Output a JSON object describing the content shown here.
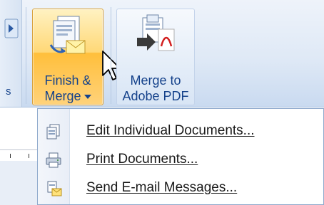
{
  "ribbon": {
    "left_group_stub_label": "s",
    "finish_merge": {
      "line1": "Finish &",
      "line2": "Merge",
      "has_dropdown": true
    },
    "merge_to_pdf": {
      "line1": "Merge to",
      "line2": "Adobe PDF"
    }
  },
  "menu": {
    "items": [
      {
        "label": "Edit Individual Documents...",
        "icon": "edit-documents-icon"
      },
      {
        "label": "Print Documents...",
        "icon": "print-documents-icon"
      },
      {
        "label": "Send E-mail Messages...",
        "icon": "email-messages-icon"
      }
    ]
  },
  "colors": {
    "ribbon_text": "#15428b",
    "active_button": "#ffd877",
    "menu_border": "#8ea9cc"
  }
}
